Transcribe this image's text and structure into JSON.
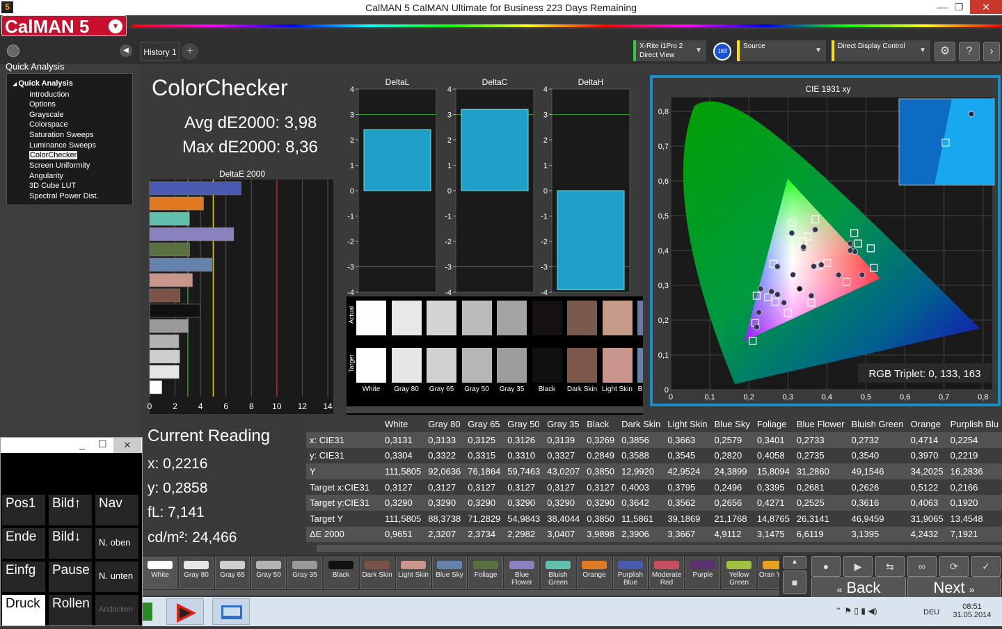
{
  "window": {
    "title": "CalMAN 5 CalMAN Ultimate for Business 223 Days Remaining",
    "app_icon": "5",
    "min": "—",
    "max": "❐",
    "close": "✕"
  },
  "logo": "CalMAN 5",
  "sidebar": {
    "title": "Quick Analysis",
    "tree_root": "Quick Analysis",
    "items": [
      "Introduction",
      "Options",
      "Grayscale",
      "Colorspace",
      "Saturation Sweeps",
      "Luminance Sweeps",
      "ColorChecker",
      "Screen Uniformity",
      "Angularity",
      "3D Cube LUT",
      "Spectral Power Dist."
    ],
    "selected": "ColorChecker"
  },
  "tabs": {
    "history": "History 1",
    "add": "+"
  },
  "devices": {
    "meter": {
      "line1": "X-Rite i1Pro 2",
      "line2": "Direct View",
      "badge": "183"
    },
    "source": "Source",
    "display": "Direct Display Control"
  },
  "colorchecker": {
    "title": "ColorChecker",
    "avg": "Avg dE2000: 3,98",
    "max": "Max dE2000: 8,36"
  },
  "deltae_chart": {
    "title": "DeltaE 2000",
    "ticks": [
      "0",
      "2",
      "4",
      "6",
      "8",
      "10",
      "12",
      "14"
    ]
  },
  "delta_charts": {
    "titles": [
      "DeltaL",
      "DeltaC",
      "DeltaH"
    ],
    "ticks": [
      "4",
      "3",
      "2",
      "1",
      "0",
      "-1",
      "-2",
      "-3",
      "-4"
    ]
  },
  "patch_labels": {
    "actual": "Actual",
    "target": "Target"
  },
  "patches": [
    "White",
    "Gray 80",
    "Gray 65",
    "Gray 50",
    "Gray 35",
    "Black",
    "Dark Skin",
    "Light Skin",
    "B"
  ],
  "cie": {
    "title": "CIE 1931 xy",
    "rgb": "RGB Triplet: 0, 133, 163",
    "yticks": [
      "0,8",
      "0,7",
      "0,6",
      "0,5",
      "0,4",
      "0,3",
      "0,2",
      "0,1",
      "0"
    ],
    "xticks": [
      "0",
      "0,1",
      "0,2",
      "0,3",
      "0,4",
      "0,5",
      "0,6",
      "0,7",
      "0,8"
    ]
  },
  "chart_data": {
    "type": "bar",
    "title": "DeltaE 2000",
    "categories": [
      "White",
      "Gray 80",
      "Gray 65",
      "Gray 50",
      "Gray 35",
      "Black",
      "Dark Skin",
      "Light Skin",
      "Blue Sky",
      "Foliage",
      "Blue Flower",
      "Bluish Green",
      "Orange",
      "Purplish Blue"
    ],
    "values": [
      0.9651,
      2.3207,
      2.3734,
      2.2982,
      3.0407,
      3.9898,
      2.3906,
      3.3667,
      4.9112,
      3.1475,
      6.6119,
      3.1395,
      4.2432,
      7.1921
    ],
    "xlim": [
      0,
      14
    ]
  },
  "reading": {
    "title": "Current Reading",
    "x": "x: 0,2216",
    "y": "y: 0,2858",
    "fl": "fL: 7,141",
    "cdm": "cd/m²: 24,466"
  },
  "table": {
    "headers": [
      "",
      "White",
      "Gray 80",
      "Gray 65",
      "Gray 50",
      "Gray 35",
      "Black",
      "Dark Skin",
      "Light Skin",
      "Blue Sky",
      "Foliage",
      "Blue Flower",
      "Bluish Green",
      "Orange",
      "Purplish Blu"
    ],
    "rows": [
      [
        "x: CIE31",
        "0,3131",
        "0,3133",
        "0,3125",
        "0,3126",
        "0,3139",
        "0,3269",
        "0,3856",
        "0,3663",
        "0,2579",
        "0,3401",
        "0,2733",
        "0,2732",
        "0,4714",
        "0,2254"
      ],
      [
        "y: CIE31",
        "0,3304",
        "0,3322",
        "0,3315",
        "0,3310",
        "0,3327",
        "0,2849",
        "0,3588",
        "0,3545",
        "0,2820",
        "0,4058",
        "0,2735",
        "0,3540",
        "0,3970",
        "0,2219"
      ],
      [
        "Y",
        "111,5805",
        "92,0636",
        "76,1864",
        "59,7463",
        "43,0207",
        "0,3850",
        "12,9920",
        "42,9524",
        "24,3899",
        "15,8094",
        "31,2860",
        "49,1546",
        "34,2025",
        "16,2836"
      ],
      [
        "Target x:CIE31",
        "0,3127",
        "0,3127",
        "0,3127",
        "0,3127",
        "0,3127",
        "0,3127",
        "0,4003",
        "0,3795",
        "0,2496",
        "0,3395",
        "0,2681",
        "0,2626",
        "0,5122",
        "0,2166"
      ],
      [
        "Target y:CIE31",
        "0,3290",
        "0,3290",
        "0,3290",
        "0,3290",
        "0,3290",
        "0,3290",
        "0,3642",
        "0,3562",
        "0,2656",
        "0,4271",
        "0,2525",
        "0,3616",
        "0,4063",
        "0,1920"
      ],
      [
        "Target Y",
        "111,5805",
        "88,3738",
        "71,2829",
        "54,9843",
        "38,4044",
        "0,3850",
        "11,5861",
        "39,1869",
        "21,1768",
        "14,8765",
        "26,3141",
        "46,9459",
        "31,9065",
        "13,4548"
      ],
      [
        "ΔE 2000",
        "0,9651",
        "2,3207",
        "2,3734",
        "2,2982",
        "3,0407",
        "3,9898",
        "2,3906",
        "3,3667",
        "4,9112",
        "3,1475",
        "6,6119",
        "3,1395",
        "4,2432",
        "7,1921"
      ]
    ]
  },
  "keyboard": {
    "min": "_",
    "max": "☐",
    "close": "✕",
    "keys": [
      "Pos1",
      "Bild↑",
      "Nav",
      "Ende",
      "Bild↓",
      "N. oben",
      "Einfg",
      "Pause",
      "N. unten",
      "Druck",
      "Rollen",
      "Andocken"
    ]
  },
  "swatches": [
    {
      "label": "White",
      "color": "#ffffff"
    },
    {
      "label": "Gray 80",
      "color": "#e6e6e6"
    },
    {
      "label": "Gray 65",
      "color": "#cfcfcf"
    },
    {
      "label": "Gray 50",
      "color": "#b3b3b3"
    },
    {
      "label": "Gray 35",
      "color": "#9a9a9a"
    },
    {
      "label": "Black",
      "color": "#111111"
    },
    {
      "label": "Dark Skin",
      "color": "#7a5246"
    },
    {
      "label": "Light Skin",
      "color": "#c8968a"
    },
    {
      "label": "Blue Sky",
      "color": "#6582ad"
    },
    {
      "label": "Foliage",
      "color": "#5a7040"
    },
    {
      "label": "Blue Flower",
      "color": "#8882bf"
    },
    {
      "label": "Bluish Green",
      "color": "#62c1ad"
    },
    {
      "label": "Orange",
      "color": "#e07a20"
    },
    {
      "label": "Purplish Blue",
      "color": "#4a5ab0"
    },
    {
      "label": "Moderate Red",
      "color": "#c8505e"
    },
    {
      "label": "Purple",
      "color": "#5a3070"
    },
    {
      "label": "Yellow Green",
      "color": "#a0c040"
    },
    {
      "label": "Oran Yello",
      "color": "#e8a020"
    }
  ],
  "controls": {
    "back": "Back",
    "next": "Next"
  },
  "tray": {
    "lang": "DEU",
    "time": "08:51",
    "date": "31.05.2014"
  }
}
